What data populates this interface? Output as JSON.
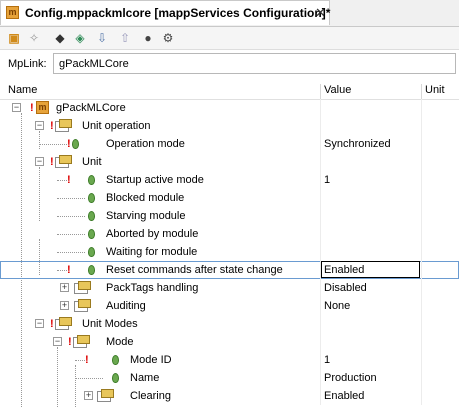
{
  "tab": {
    "title": "Config.mppackmlcore [mappServices Configuration]*",
    "close": "✕",
    "icon": "m"
  },
  "toolbar": {
    "icons": [
      "config-icon",
      "wand-icon",
      "collapse-icon",
      "expand-icon",
      "sort-desc-icon",
      "sort-asc-icon",
      "circle-icon",
      "gear-icon"
    ]
  },
  "mplink": {
    "label": "MpLink:",
    "value": "gPackMLCore"
  },
  "columns": {
    "name": "Name",
    "value": "Value",
    "unit": "Unit"
  },
  "rows": [
    {
      "label": "gPackMLCore",
      "value": ""
    },
    {
      "label": "Unit operation",
      "value": ""
    },
    {
      "label": "Operation mode",
      "value": "Synchronized"
    },
    {
      "label": "Unit",
      "value": ""
    },
    {
      "label": "Startup active mode",
      "value": "1"
    },
    {
      "label": "Blocked module",
      "value": ""
    },
    {
      "label": "Starving module",
      "value": ""
    },
    {
      "label": "Aborted by module",
      "value": ""
    },
    {
      "label": "Waiting for module",
      "value": ""
    },
    {
      "label": "Reset commands after state change",
      "value": "Enabled"
    },
    {
      "label": "PackTags handling",
      "value": "Disabled"
    },
    {
      "label": "Auditing",
      "value": "None"
    },
    {
      "label": "Unit Modes",
      "value": ""
    },
    {
      "label": "Mode",
      "value": ""
    },
    {
      "label": "Mode ID",
      "value": "1"
    },
    {
      "label": "Name",
      "value": "Production"
    },
    {
      "label": "Clearing",
      "value": "Enabled"
    }
  ]
}
